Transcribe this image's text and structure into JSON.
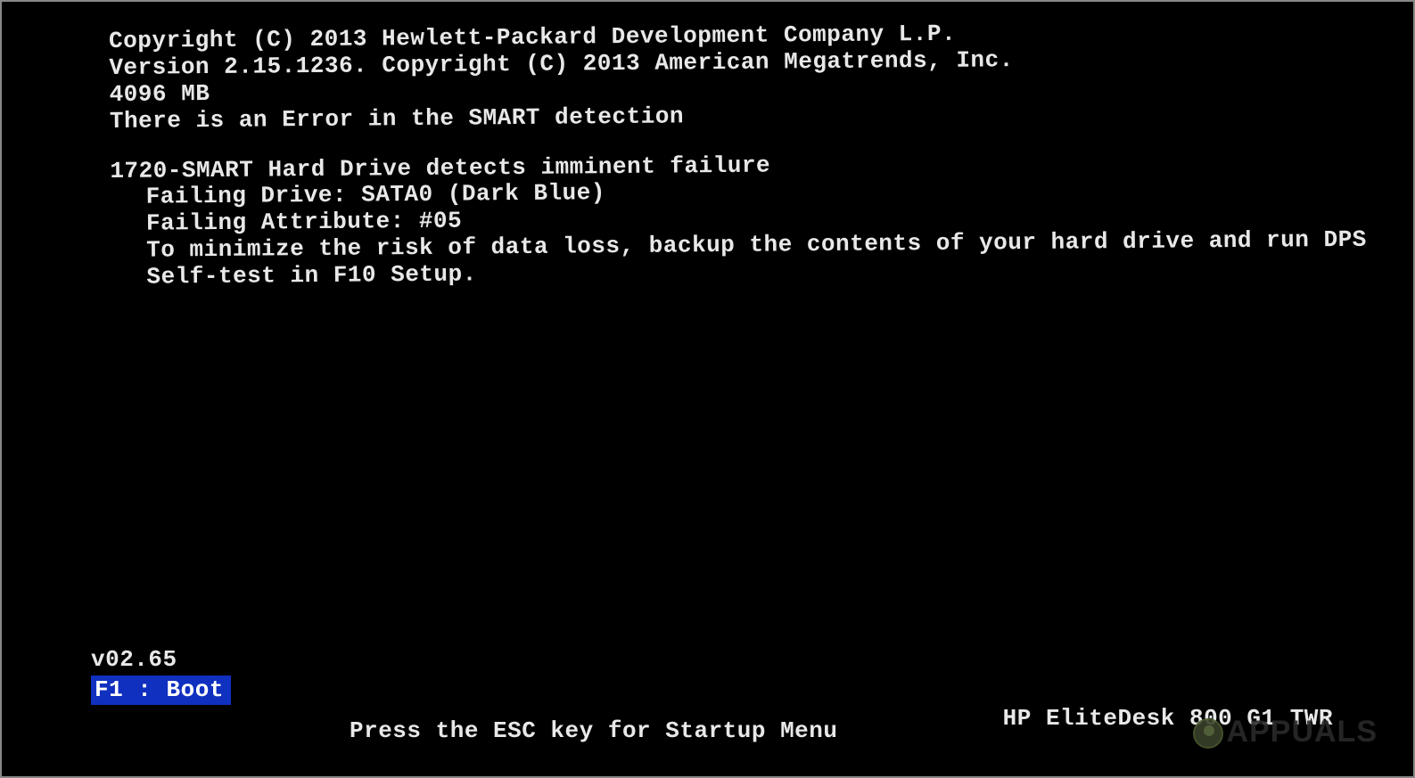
{
  "header": {
    "copyright1": "Copyright (C) 2013 Hewlett-Packard Development Company L.P.",
    "copyright2": "Version 2.15.1236. Copyright (C) 2013 American Megatrends, Inc.",
    "memory": "4096 MB",
    "error_line": "There is an Error in the SMART detection"
  },
  "smart": {
    "title": "1720-SMART Hard Drive detects imminent failure",
    "failing_drive": "Failing Drive: SATA0 (Dark Blue)",
    "failing_attr": "Failing Attribute: #05",
    "advice": "To minimize the risk of data loss, backup the contents of your hard drive and run DPS Self-test in F10 Setup."
  },
  "footer": {
    "bios_version": "v02.65",
    "boot_prompt": "F1 : Boot",
    "esc_prompt": "Press the ESC key for Startup Menu",
    "model": "HP EliteDesk 800 G1 TWR"
  },
  "watermark": {
    "text": "APPUALS"
  }
}
